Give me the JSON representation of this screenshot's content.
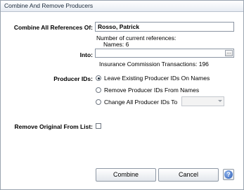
{
  "window": {
    "title": "Combine And Remove Producers"
  },
  "combine": {
    "label": "Combine All References Of:",
    "value": "Rosso, Patrick",
    "references_label": "Number of current references:",
    "names_count": "Names: 6"
  },
  "into": {
    "label": "Into:",
    "value": "",
    "browse_label": "...",
    "transactions_text": "Insurance Commission Transactions: 196"
  },
  "producer_ids": {
    "label": "Producer IDs:",
    "options": [
      {
        "label": "Leave Existing Producer IDs On Names",
        "selected": true
      },
      {
        "label": "Remove Producer IDs From Names",
        "selected": false
      },
      {
        "label": "Change All Producer IDs To",
        "selected": false
      }
    ],
    "change_to_value": ""
  },
  "remove_original": {
    "label": "Remove Original From List:",
    "checked": false
  },
  "buttons": {
    "combine": "Combine",
    "cancel": "Cancel",
    "help_glyph": "?"
  },
  "icons": {
    "help": "help-icon",
    "browse": "ellipsis-icon"
  },
  "colors": {
    "title_text": "#1b2a3a",
    "help_blue": "#2b5bb5"
  }
}
